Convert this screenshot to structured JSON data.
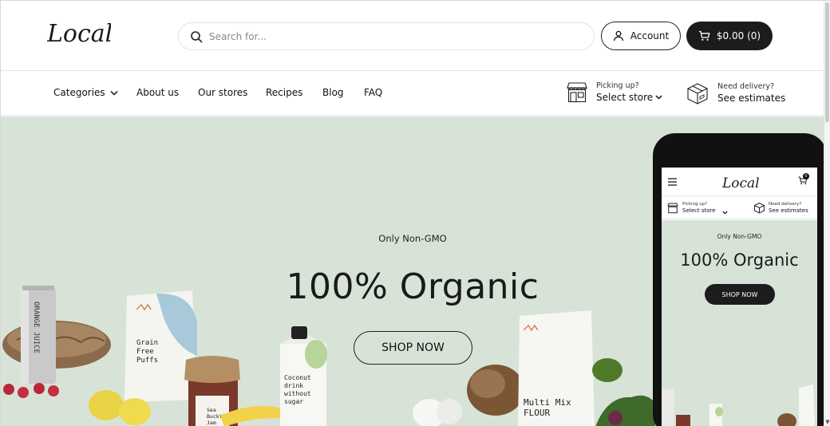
{
  "header": {
    "logo_text": "Local",
    "search": {
      "placeholder": "Search for..."
    },
    "account_label": "Account",
    "cart_label": "$0.00 (0)"
  },
  "nav": {
    "items": [
      {
        "label": "Categories"
      },
      {
        "label": "About us"
      },
      {
        "label": "Our stores"
      },
      {
        "label": "Recipes"
      },
      {
        "label": "Blog"
      },
      {
        "label": "FAQ"
      }
    ],
    "pickup": {
      "small": "Picking up?",
      "strong": "Select store"
    },
    "delivery": {
      "small": "Need delivery?",
      "strong": "See estimates"
    }
  },
  "hero": {
    "eyebrow": "Only Non-GMO",
    "title": "100% Organic",
    "button": "SHOP NOW",
    "background": "#d8e3d8"
  },
  "products": {
    "orange_juice": "ORANGE JUICE",
    "puffs": [
      "Grain",
      "Free",
      "Puffs"
    ],
    "coconut": [
      "Coconut",
      "drink",
      "without",
      "sugar"
    ],
    "flour": [
      "Multi Mix",
      "FLOUR"
    ],
    "jam": [
      "Sea",
      "Buckthorn",
      "Jam"
    ]
  },
  "mobile": {
    "logo_text": "Local",
    "cart_count": "0",
    "pickup": {
      "small": "Picking up?",
      "strong": "Select store"
    },
    "delivery": {
      "small": "Need delivery?",
      "strong": "See estimates"
    },
    "eyebrow": "Only Non-GMO",
    "title": "100% Organic",
    "button": "SHOP NOW"
  },
  "colors": {
    "accent": "#1c1c1c",
    "hero_bg": "#d8e3d8"
  }
}
